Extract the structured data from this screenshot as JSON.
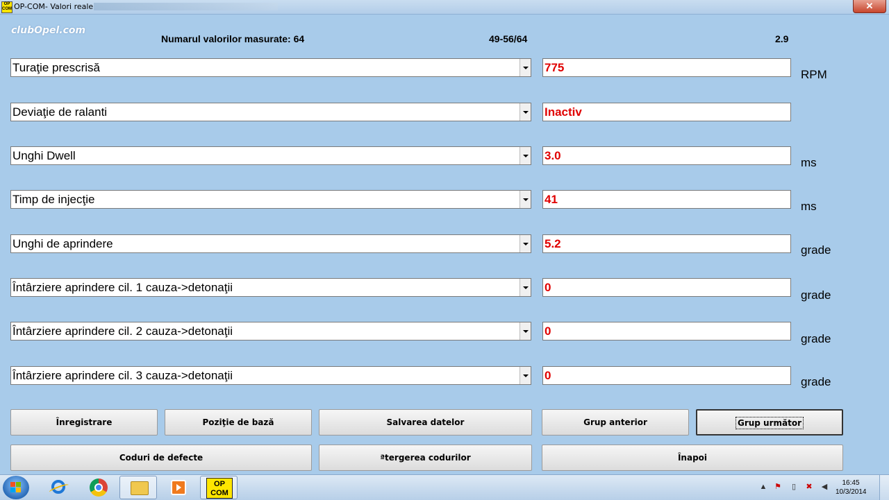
{
  "window": {
    "title": "OP-COM- Valori reale",
    "close_glyph": "✕",
    "icon_text": "OP COM"
  },
  "logo": "clubOpel.com",
  "header": {
    "measured_label": "Numarul valorilor masurate: 64",
    "range": "49-56/64",
    "version": "2.9"
  },
  "rows": [
    {
      "name": "Turaţie prescrisă",
      "value": "775",
      "unit": "RPM"
    },
    {
      "name": "Deviaţie de ralanti",
      "value": "Inactiv",
      "unit": ""
    },
    {
      "name": "Unghi Dwell",
      "value": "3.0",
      "unit": "ms"
    },
    {
      "name": "Timp de injecţie",
      "value": "41",
      "unit": "ms"
    },
    {
      "name": "Unghi de aprindere",
      "value": "5.2",
      "unit": "grade"
    },
    {
      "name": "Întârziere aprindere cil. 1 cauza->detonaţii",
      "value": "0",
      "unit": "grade"
    },
    {
      "name": "Întârziere aprindere cil. 2 cauza->detonaţii",
      "value": "0",
      "unit": "grade"
    },
    {
      "name": "Întârziere aprindere cil. 3 cauza->detonaţii",
      "value": "0",
      "unit": "grade"
    }
  ],
  "buttons": {
    "record": "Înregistrare",
    "base_position": "Poziţie de bază",
    "save_data": "Salvarea datelor",
    "prev_group": "Grup anterior",
    "next_group": "Grup următor",
    "fault_codes": "Coduri de defecte",
    "clear_codes": "ªtergerea codurilor",
    "back": "Înapoi"
  },
  "taskbar": {
    "opcom_label_1": "OP",
    "opcom_label_2": "COM",
    "time": "16:45",
    "date": "10/3/2014"
  },
  "colors": {
    "value_text": "#e00000",
    "background": "#a8cbea"
  }
}
